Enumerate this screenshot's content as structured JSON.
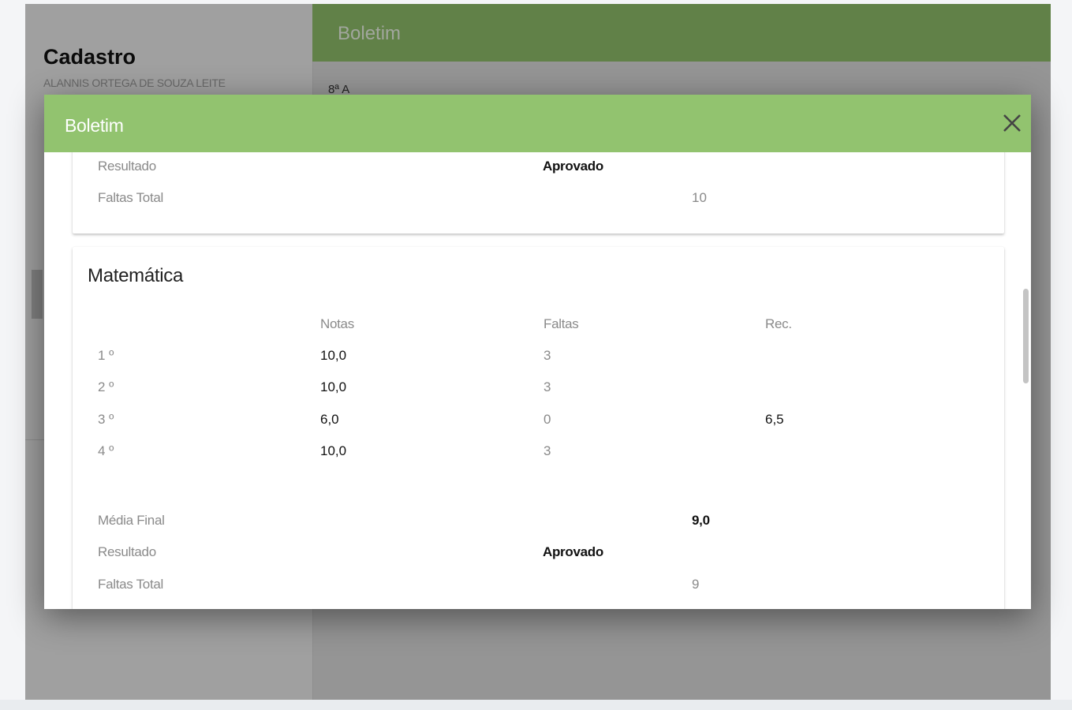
{
  "background": {
    "left_title": "Cadastro",
    "left_subtitle": "ALANNIS ORTEGA DE SOUZA LEITE",
    "right_title": "Boletim",
    "right_class": "8ª A"
  },
  "modal": {
    "title": "Boletim",
    "close_icon": "close-icon",
    "previous_card": {
      "result_label": "Resultado",
      "result_value": "Aprovado",
      "absences_label": "Faltas Total",
      "absences_value": "10"
    },
    "subject_card": {
      "subject": "Matemática",
      "columns": {
        "grades": "Notas",
        "absences": "Faltas",
        "rec": "Rec."
      },
      "rows": [
        {
          "term": "1 º",
          "grade": "10,0",
          "absences": "3",
          "rec": ""
        },
        {
          "term": "2 º",
          "grade": "10,0",
          "absences": "3",
          "rec": ""
        },
        {
          "term": "3 º",
          "grade": "6,0",
          "absences": "0",
          "rec": "6,5"
        },
        {
          "term": "4 º",
          "grade": "10,0",
          "absences": "3",
          "rec": ""
        }
      ],
      "final_avg_label": "Média Final",
      "final_avg_value": "9,0",
      "result_label": "Resultado",
      "result_value": "Aprovado",
      "absences_label": "Faltas Total",
      "absences_value": "9"
    }
  },
  "colors": {
    "modal_header": "#92c36f",
    "background_header": "#8fbf6a"
  }
}
